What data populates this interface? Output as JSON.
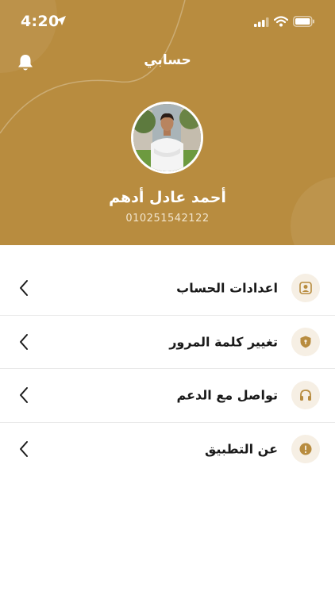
{
  "status_bar": {
    "time": "4:20"
  },
  "header": {
    "title": "حسابي"
  },
  "profile": {
    "name": "أحمد عادل أدهم",
    "phone": "010251542122"
  },
  "menu": {
    "items": [
      {
        "label": "اعدادات الحساب",
        "icon": "user-profile-icon"
      },
      {
        "label": "تغيير كلمة المرور",
        "icon": "shield-lock-icon"
      },
      {
        "label": "تواصل مع الدعم",
        "icon": "headphones-icon"
      },
      {
        "label": "عن التطبيق",
        "icon": "info-icon"
      }
    ]
  },
  "colors": {
    "brand": "#b88c3f",
    "icon_bg": "#f6efe4",
    "text": "#1a1a1a",
    "divider": "#e9e9e9"
  }
}
